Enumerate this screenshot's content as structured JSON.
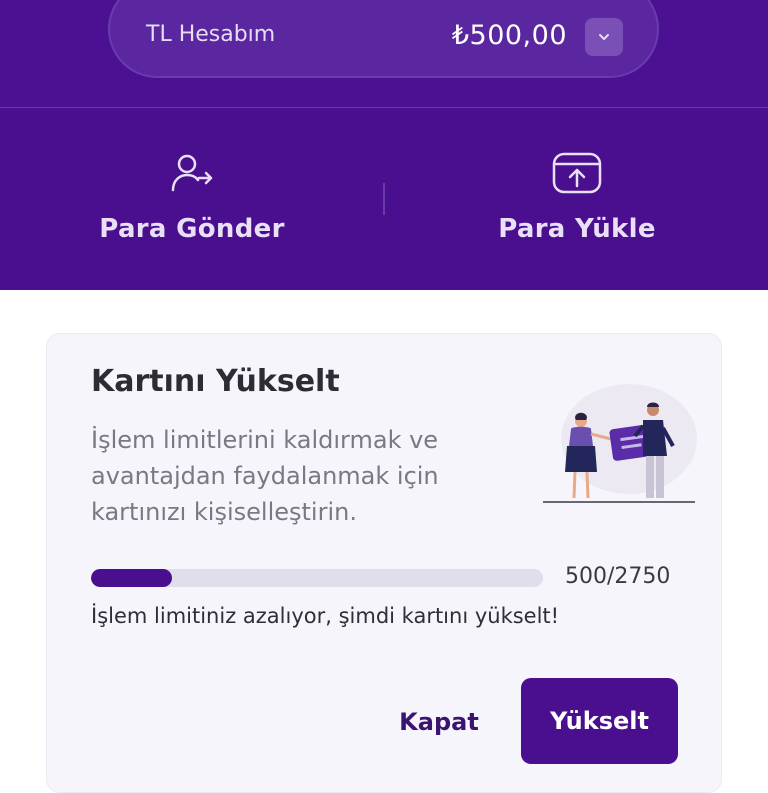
{
  "account": {
    "label": "TL Hesabım",
    "balance": "₺500,00",
    "dropdown_icon": "chevron-down-icon"
  },
  "actions": [
    {
      "label": "Para Gönder",
      "icon": "user-send-icon"
    },
    {
      "label": "Para Yükle",
      "icon": "wallet-upload-icon"
    }
  ],
  "upgrade_card": {
    "title": "Kartını Yükselt",
    "description": "İşlem limitlerini kaldırmak ve avantajdan faydalanmak için kartınızı kişiselleştirin.",
    "progress_text": "500/2750",
    "progress_value": 0.18,
    "warning": "İşlem limitiniz azalıyor, şimdi kartını yükselt!",
    "close_label": "Kapat",
    "upgrade_label": "Yükselt"
  },
  "colors": {
    "brand_purple": "#4a0f8f",
    "card_bg": "#f6f5fb",
    "progress_track": "#e1deec"
  }
}
